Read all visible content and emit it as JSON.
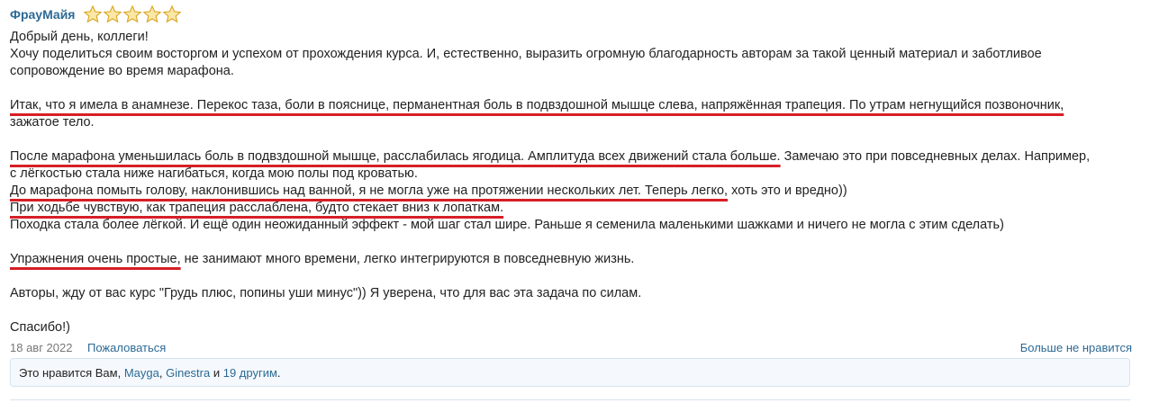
{
  "post": {
    "author": "ФрауМайя",
    "rating": {
      "value": 5,
      "max": 5
    },
    "date": "18 авг 2022",
    "report_label": "Пожаловаться",
    "unlike_label": "Больше не нравится",
    "body": {
      "p1": "Добрый день, коллеги!",
      "p2": "Хочу поделиться своим восторгом и успехом от прохождения курса. И, естественно, выразить огромную благодарность авторам за такой ценный материал и заботливое",
      "p3": "сопровождение во время марафона.",
      "p4_hl": "Итак, что я имела в анамнезе. Перекос таза, боли в пояснице, перманентная боль в подвздошной мышце слева, напряжённая трапеция. По утрам негнущийся позвоночник,",
      "p5": "зажатое тело.",
      "p6_hl": "После марафона уменьшилась боль в подвздошной мышце, расслабилась ягодица. Амплитуда всех движений стала больше.",
      "p6_rest": " Замечаю это при повседневных делах. Например,",
      "p7": "с лёгкостью стала ниже нагибаться, когда мою полы под кроватью.",
      "p8_hl": "До марафона помыть голову, наклонившись над ванной, я не могла уже на протяжении нескольких лет. Теперь легко,",
      "p8_rest": " хоть это и вредно))",
      "p9_hl": "При ходьбе чувствую, как трапеция расслаблена, будто стекает вниз к лопаткам.",
      "p10": "Походка стала более лёгкой. И ещё один неожиданный эффект - мой шаг стал шире. Раньше я семенила маленькими шажками и ничего не могла с этим сделать)",
      "p11_hl": "Упражнения очень простые,",
      "p11_rest": " не занимают много времени, легко интегрируются в повседневную жизнь.",
      "p12": "Авторы, жду от вас курс \"Грудь плюс, попины уши минус\")) Я уверена, что для вас эта задача по силам.",
      "p13": "Спасибо!)"
    },
    "likes": {
      "prefix": "Это нравится Вам, ",
      "user1": "Mayga",
      "sep": ", ",
      "user2": "Ginestra",
      "and": " и ",
      "others": "19 другим",
      "end": "."
    },
    "colors": {
      "link": "#2c6a95",
      "highlight": "#d61f26",
      "star": "#f4c430"
    },
    "icons": {
      "star": "star-icon"
    }
  }
}
